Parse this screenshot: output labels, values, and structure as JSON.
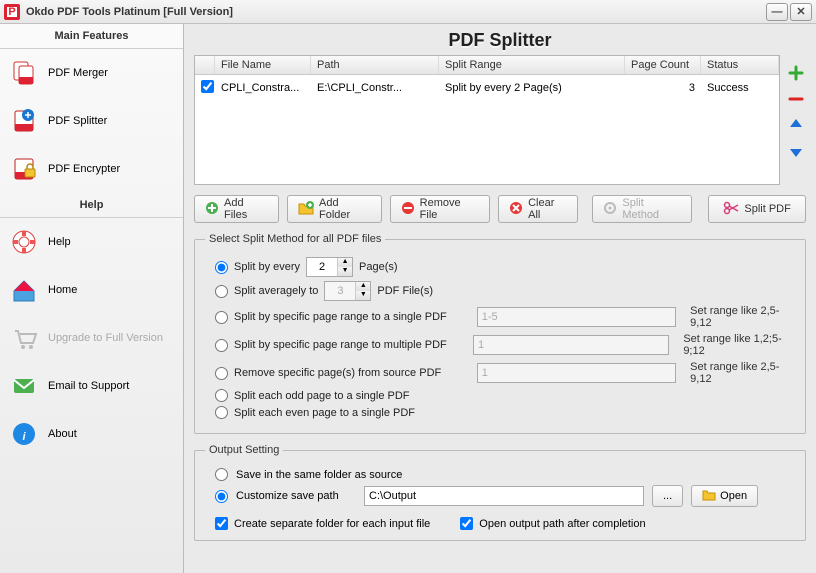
{
  "window": {
    "title": "Okdo PDF Tools Platinum [Full Version]"
  },
  "sidebar": {
    "header_features": "Main Features",
    "header_help": "Help",
    "items": [
      {
        "label": "PDF Merger"
      },
      {
        "label": "PDF Splitter"
      },
      {
        "label": "PDF Encrypter"
      },
      {
        "label": "Help"
      },
      {
        "label": "Home"
      },
      {
        "label": "Upgrade to Full Version"
      },
      {
        "label": "Email to Support"
      },
      {
        "label": "About"
      }
    ]
  },
  "content": {
    "title": "PDF Splitter",
    "columns": {
      "filename": "File Name",
      "path": "Path",
      "range": "Split Range",
      "pagecount": "Page Count",
      "status": "Status"
    },
    "rows": [
      {
        "checked": true,
        "filename": "CPLI_Constra...",
        "path": "E:\\CPLI_Constr...",
        "range": "Split by every 2 Page(s)",
        "pagecount": "3",
        "status": "Success"
      }
    ],
    "toolbar": {
      "add_files": "Add Files",
      "add_folder": "Add Folder",
      "remove_file": "Remove File",
      "clear_all": "Clear All",
      "split_method": "Split Method",
      "split_pdf": "Split PDF"
    },
    "split_group": {
      "legend": "Select Split Method for all PDF files",
      "opt_every": "Split by every",
      "opt_every_value": "2",
      "opt_every_suffix": "Page(s)",
      "opt_avg": "Split averagely to",
      "opt_avg_value": "3",
      "opt_avg_suffix": "PDF File(s)",
      "opt_range_single": "Split by specific page range to a single PDF",
      "opt_range_single_ph": "1-5",
      "opt_range_single_hint": "Set range like 2,5-9,12",
      "opt_range_multi": "Split by specific page range to multiple PDF",
      "opt_range_multi_ph": "1",
      "opt_range_multi_hint": "Set range like 1,2;5-9;12",
      "opt_remove": "Remove specific page(s) from source PDF",
      "opt_remove_ph": "1",
      "opt_remove_hint": "Set range like 2,5-9,12",
      "opt_odd": "Split each odd page to a single PDF",
      "opt_even": "Split each even page to a single PDF"
    },
    "output_group": {
      "legend": "Output Setting",
      "opt_same": "Save in the same folder as source",
      "opt_custom": "Customize save path",
      "path_value": "C:\\Output",
      "browse": "...",
      "open": "Open",
      "chk_sep": "Create separate folder for each input file",
      "chk_open_after": "Open output path after completion"
    }
  }
}
